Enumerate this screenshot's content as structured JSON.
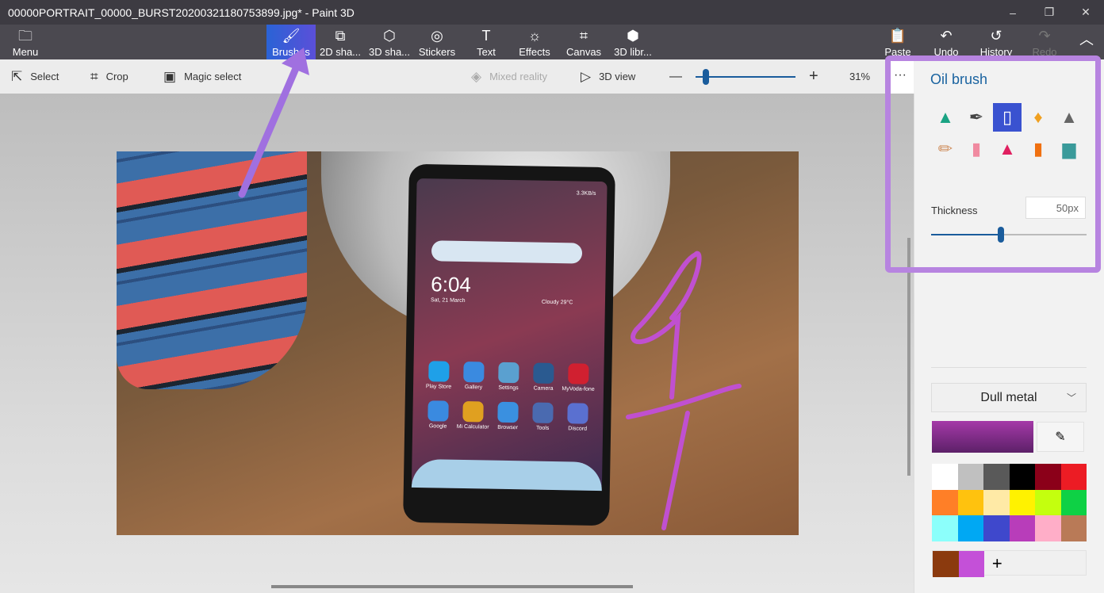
{
  "window": {
    "title": "00000PORTRAIT_00000_BURST20200321180753899.jpg* - Paint 3D",
    "minimize": "–",
    "restore": "❐",
    "close": "✕"
  },
  "toolbar": {
    "menu": "Menu",
    "tools": [
      "Brushes",
      "2D sha...",
      "3D sha...",
      "Stickers",
      "Text",
      "Effects",
      "Canvas",
      "3D libr..."
    ],
    "right": [
      "Paste",
      "Undo",
      "History",
      "Redo"
    ],
    "active": "Brushes"
  },
  "subbar": {
    "select": "Select",
    "crop": "Crop",
    "magic_select": "Magic select",
    "mixed_reality": "Mixed reality",
    "view3d": "3D view",
    "zoom": "31%",
    "zoom_minus": "—",
    "zoom_plus": "+",
    "zoom_level": 0.1,
    "more": "···"
  },
  "phone": {
    "time": "6:04",
    "date": "Sat, 21 March",
    "weather": "Cloudy  29°C",
    "status": "3.3KB/s",
    "apps": [
      "Play Store",
      "Gallery",
      "Settings",
      "Camera",
      "MyVoda-fone",
      "Google",
      "Mi Calculator",
      "Browser",
      "Tools",
      "Discord"
    ]
  },
  "panel": {
    "title": "Oil brush",
    "brushes": [
      "marker",
      "calligraphy-pen",
      "oil-brush",
      "watercolor",
      "pixel-pen",
      "pencil",
      "eraser",
      "crayon",
      "spray-can",
      "fill"
    ],
    "selected_brush": "oil-brush",
    "thickness_label": "Thickness",
    "thickness_value": "50px",
    "thickness_fraction": 0.45,
    "material": "Dull metal",
    "current_color": "#8a2a90",
    "palette": [
      "#ffffff",
      "#c0c0c0",
      "#595959",
      "#000000",
      "#8b0019",
      "#ec1c24",
      "#ff7f27",
      "#ffc20e",
      "#ffeaa6",
      "#fff200",
      "#c4ff0e",
      "#0ed145",
      "#8cfffb",
      "#00a8f3",
      "#3f48cc",
      "#b83dba",
      "#ffaec8",
      "#b97a57"
    ],
    "custom_colors": [
      "#8b3a0e",
      "#c450d8"
    ],
    "add_color": "+"
  },
  "accent": "#b784e0"
}
